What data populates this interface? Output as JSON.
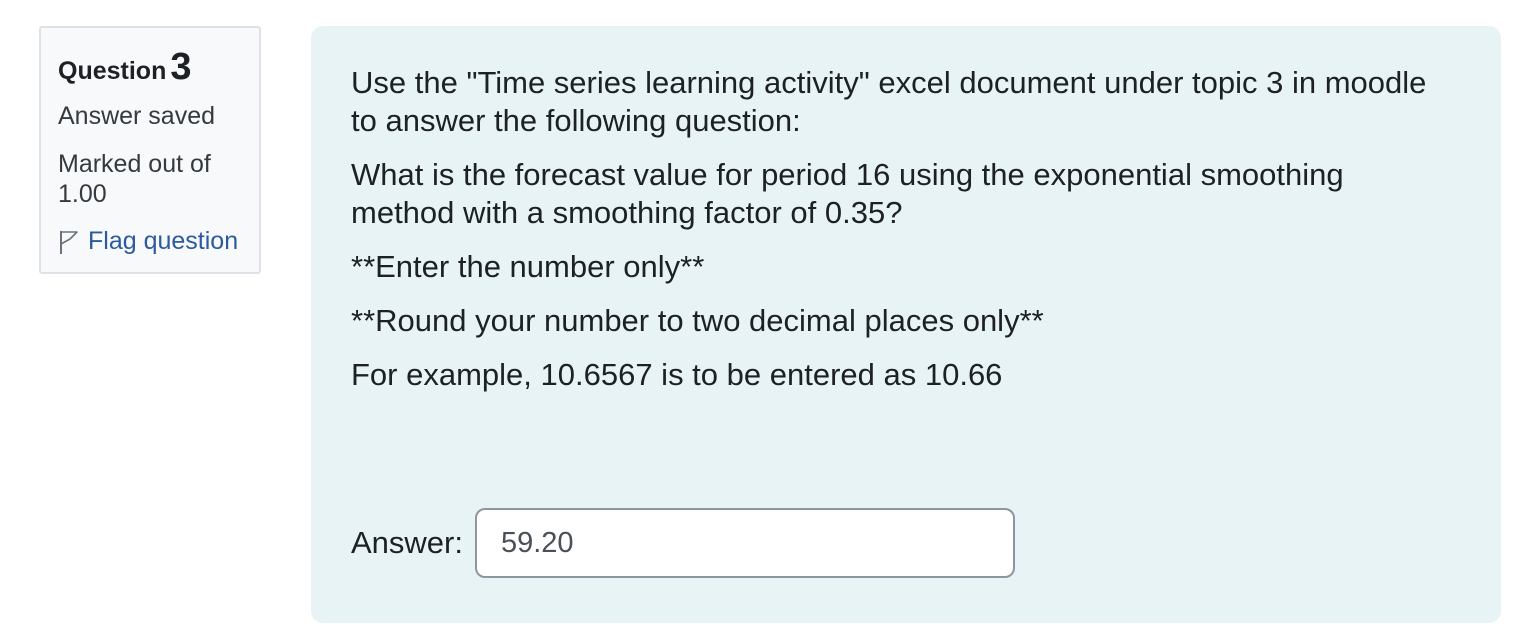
{
  "info": {
    "question_word": "Question",
    "question_number": "3",
    "state": "Answer saved",
    "grade": "Marked out of 1.00",
    "flag_label": "Flag question"
  },
  "question": {
    "paragraphs": [
      "Use the \"Time series learning activity\" excel document under topic 3 in moodle to answer the following question:",
      "What is the forecast value for period 16 using the exponential smoothing method with a smoothing factor of 0.35?",
      "**Enter the number only**",
      "**Round your number to two decimal places only**",
      "For example, 10.6567 is to be entered as 10.66"
    ]
  },
  "answer": {
    "label": "Answer:",
    "value": "59.20"
  },
  "colors": {
    "info_bg": "#f8f9fa",
    "content_bg": "#e7f3f5",
    "link": "#2b5a9e"
  },
  "icons": {
    "flag": "flag-outline-icon"
  }
}
